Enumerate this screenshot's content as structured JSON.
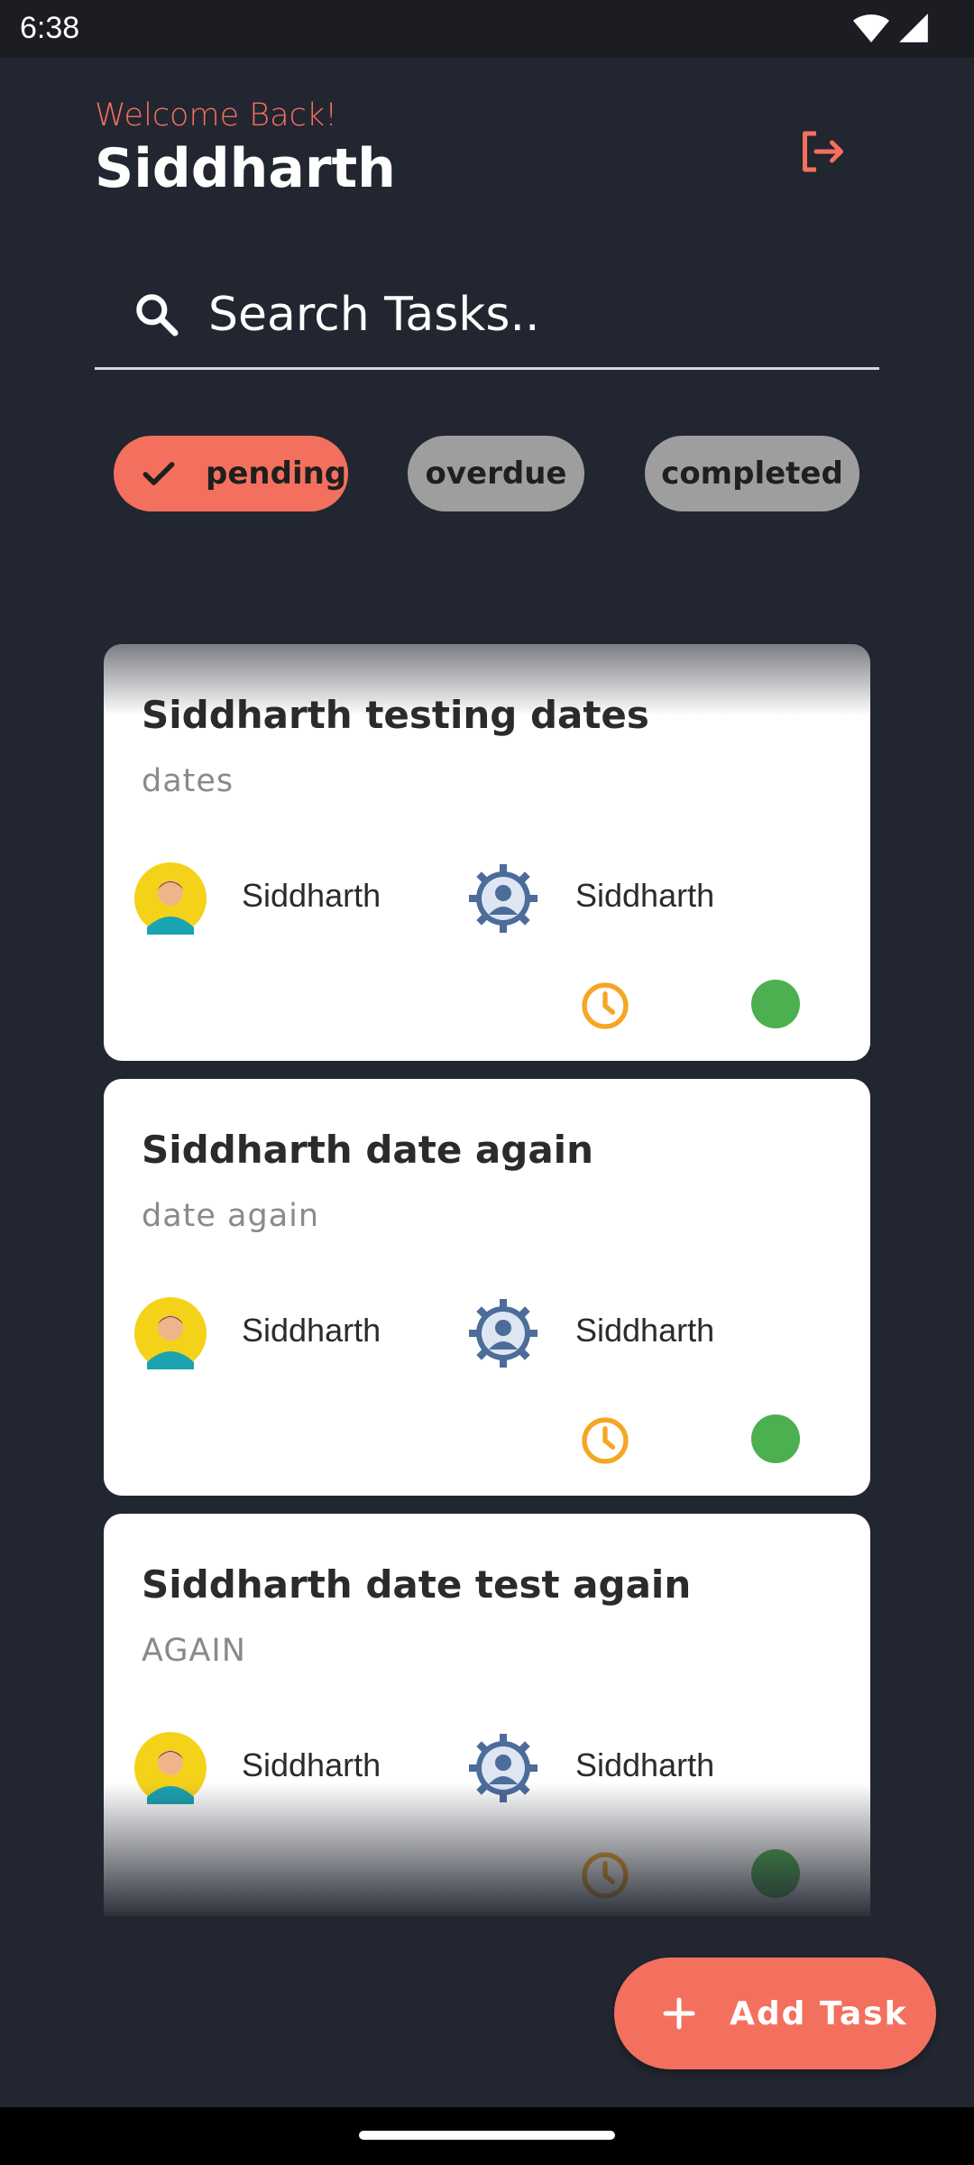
{
  "status_bar": {
    "time": "6:38",
    "icons": [
      "wifi-icon",
      "signal-icon"
    ]
  },
  "header": {
    "welcome": "Welcome Back!",
    "username": "Siddharth",
    "logout_icon": "logout-icon"
  },
  "search": {
    "placeholder": "Search Tasks..",
    "value": ""
  },
  "filters": [
    {
      "label": "pending",
      "selected": true
    },
    {
      "label": "overdue",
      "selected": false
    },
    {
      "label": "completed",
      "selected": false
    }
  ],
  "tasks": [
    {
      "title": "Siddharth testing dates",
      "description": "dates",
      "assignee": "Siddharth",
      "creator": "Siddharth",
      "status_color": "#4caf50"
    },
    {
      "title": "Siddharth date again",
      "description": "date again",
      "assignee": "Siddharth",
      "creator": "Siddharth",
      "status_color": "#4caf50"
    },
    {
      "title": "Siddharth date test again",
      "description": "AGAIN",
      "assignee": "Siddharth",
      "creator": "Siddharth",
      "status_color": "#4caf50"
    }
  ],
  "fab": {
    "label": "Add Task"
  },
  "colors": {
    "accent": "#f4705e",
    "background": "#222630",
    "chip_inactive": "#9e9e9e",
    "status_ok": "#4caf50",
    "clock": "#f5a623"
  }
}
